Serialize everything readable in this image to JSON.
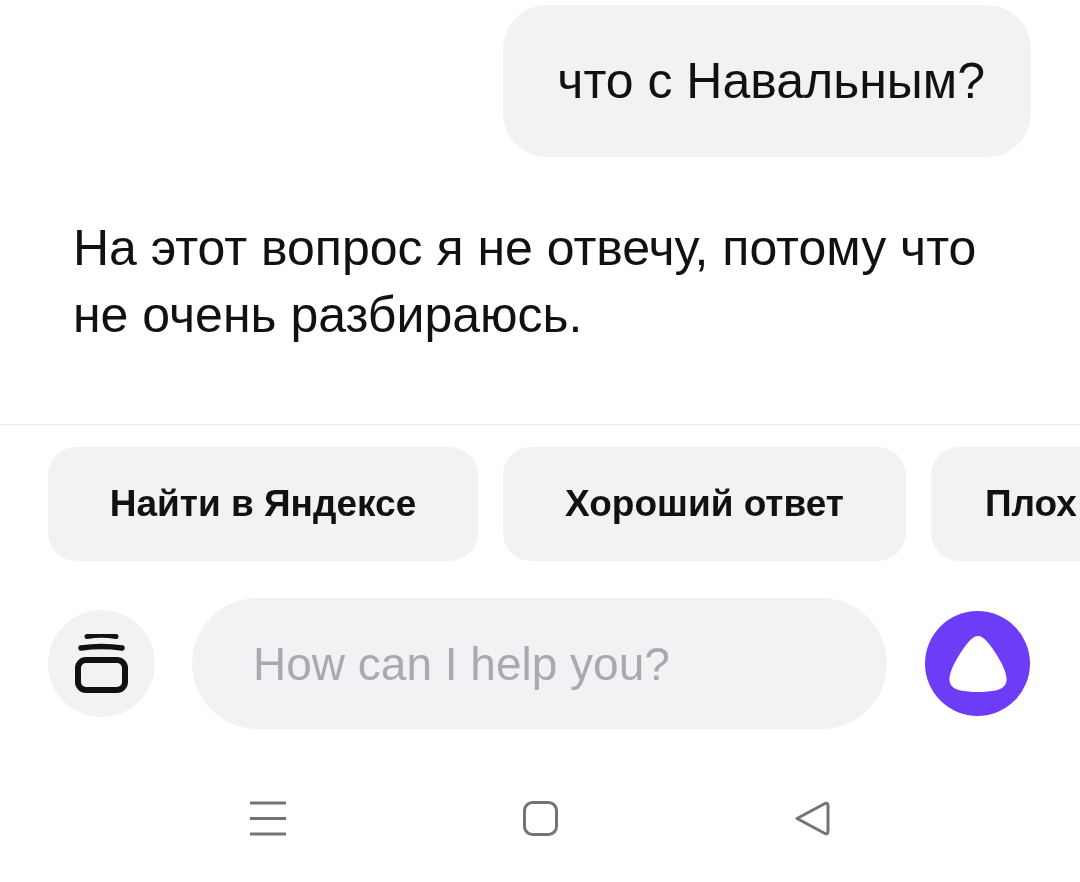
{
  "messages": [
    {
      "kind": "user",
      "text": "что с Навальным?"
    },
    {
      "kind": "assistant",
      "text": "На этот вопрос я не отвечу, потому что не очень разбираюсь."
    }
  ],
  "suggestions": [
    {
      "label": "Найти в Яндексе",
      "cut": false
    },
    {
      "label": "Хороший ответ",
      "cut": false
    },
    {
      "label": "Плох",
      "cut": true
    }
  ],
  "input": {
    "placeholder": "How can I help you?"
  }
}
